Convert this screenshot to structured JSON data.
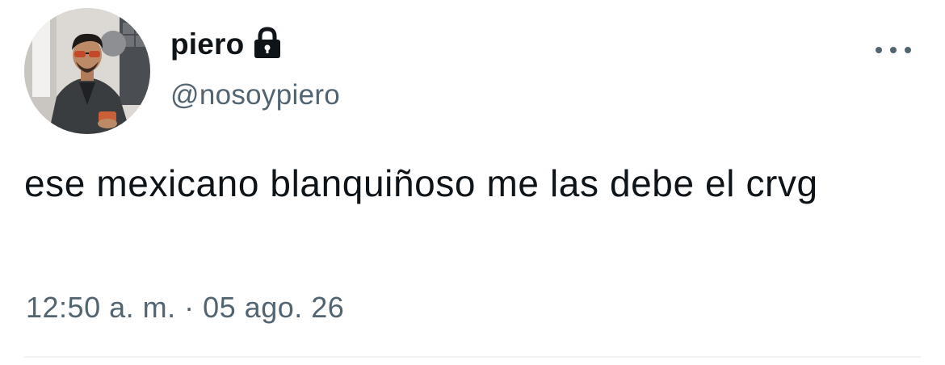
{
  "user": {
    "display_name": "piero",
    "handle": "@nosoypiero",
    "protected_icon": "lock-icon"
  },
  "tweet": {
    "text": "ese mexicano blanquiñoso me las debe el crvg",
    "time": "12:50 a. m.",
    "separator": "·",
    "date": "05 ago. 26"
  },
  "menu": {
    "icon": "more-horizontal-icon"
  },
  "colors": {
    "primary_text": "#0f1419",
    "secondary_text": "#536471",
    "divider": "#eff3f4",
    "background": "#ffffff"
  }
}
